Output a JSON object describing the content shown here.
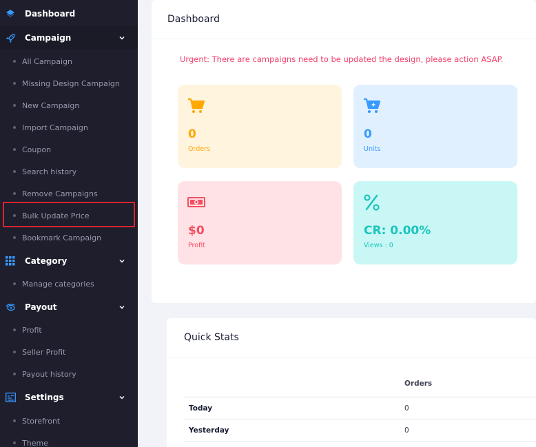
{
  "sidebar": {
    "dashboard": "Dashboard",
    "campaign": {
      "label": "Campaign",
      "items": [
        "All Campaign",
        "Missing Design Campaign",
        "New Campaign",
        "Import Campaign",
        "Coupon",
        "Search history",
        "Remove Campaigns",
        "Bulk Update Price",
        "Bookmark Campaign"
      ]
    },
    "category": {
      "label": "Category",
      "items": [
        "Manage categories"
      ]
    },
    "payout": {
      "label": "Payout",
      "items": [
        "Profit",
        "Seller Profit",
        "Payout history"
      ]
    },
    "settings": {
      "label": "Settings",
      "items": [
        "Storefront",
        "Theme"
      ]
    }
  },
  "header": {
    "title": "Dashboard"
  },
  "alert": "Urgent: There are campaigns need to be updated the design, please action ASAP.",
  "stats": {
    "orders": {
      "value": "0",
      "label": "Orders",
      "icon": "cart-icon",
      "color": "#ffa800",
      "bg": "#fff4de"
    },
    "units": {
      "value": "0",
      "label": "Units",
      "icon": "cart-plus-icon",
      "color": "#3699ff",
      "bg": "#e1f0ff"
    },
    "profit": {
      "value": "$0",
      "label": "Profit",
      "icon": "money-icon",
      "color": "#f64e60",
      "bg": "#ffe2e5"
    },
    "cr": {
      "value": "CR: 0.00%",
      "label": "Views : 0",
      "icon": "percent-icon",
      "color": "#1bc5bd",
      "bg": "#c9f7f5"
    }
  },
  "quick_stats": {
    "title": "Quick Stats",
    "column": "Orders",
    "rows": [
      {
        "label": "Today",
        "value": "0"
      },
      {
        "label": "Yesterday",
        "value": "0"
      }
    ]
  }
}
